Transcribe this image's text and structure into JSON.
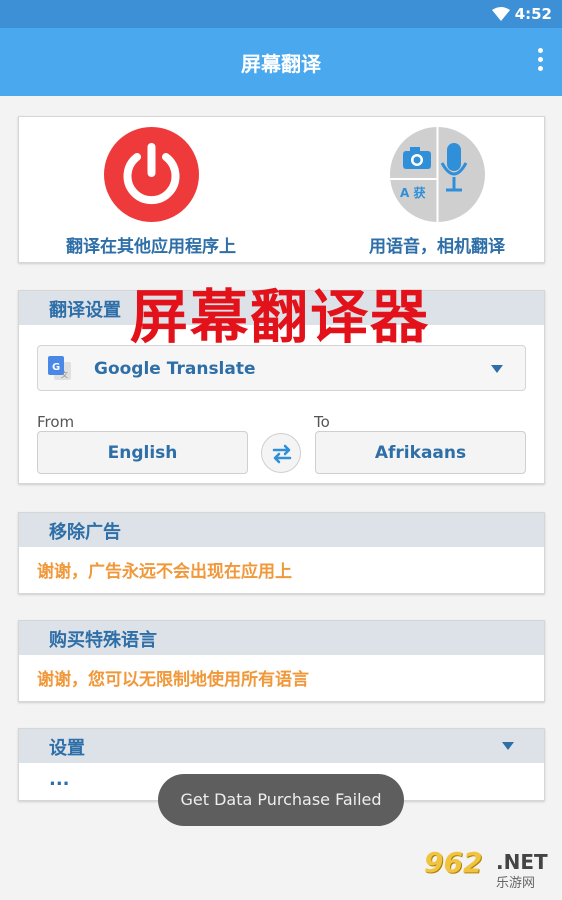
{
  "status_bar": {
    "time": "4:52",
    "wifi_icon": "wifi-icon"
  },
  "app_bar": {
    "title": "屏幕翻译",
    "menu_icon": "more-vert-icon"
  },
  "actions": {
    "left_label": "翻译在其他应用程序上",
    "right_label": "用语音，相机翻译",
    "right_icon_letters": "A 获"
  },
  "overlay_title": "屏幕翻译器",
  "translate_settings": {
    "header": "翻译设置",
    "engine": "Google Translate",
    "from_label": "From",
    "to_label": "To",
    "from_language": "English",
    "to_language": "Afrikaans"
  },
  "remove_ads": {
    "header": "移除广告",
    "text": "谢谢，广告永远不会出现在应用上"
  },
  "special_languages": {
    "header": "购买特殊语言",
    "text": "谢谢，您可以无限制地使用所有语言"
  },
  "preferences": {
    "header": "设置",
    "ellipsis": "..."
  },
  "toast": "Get Data Purchase Failed",
  "watermark": {
    "number": "962",
    "net": ".NET",
    "sub": "乐游网"
  },
  "colors": {
    "app_bar": "#4aa8ee",
    "status_bar": "#3d8fd6",
    "accent_blue": "#2f6fa8",
    "accent_orange": "#f0983a",
    "power_red": "#ee3a3a",
    "overlay_red": "#e3121a"
  }
}
